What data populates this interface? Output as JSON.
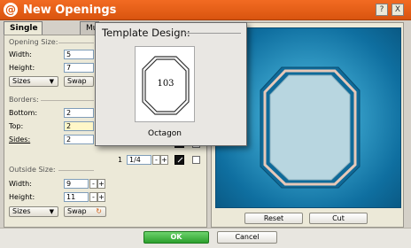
{
  "window": {
    "title": "New Openings",
    "help_label": "?",
    "close_label": "X"
  },
  "tabs": [
    {
      "label": "Single"
    },
    {
      "label": "Mu"
    }
  ],
  "opening_size": {
    "header": "Opening Size:",
    "width_label": "Width:",
    "width_value": "5",
    "height_label": "Height:",
    "height_value": "7",
    "sizes_label": "Sizes",
    "swap_label": "Swap"
  },
  "borders": {
    "header": "Borders:",
    "bottom_label": "Bottom:",
    "bottom_value": "2",
    "top_label": "Top:",
    "top_value": "2",
    "sides_label": "Sides:",
    "sides_value": "2"
  },
  "fraction_row": {
    "index": "1",
    "value": "1/4",
    "minus": "-",
    "plus": "+"
  },
  "outside_size": {
    "header": "Outside Size:",
    "width_label": "Width:",
    "width_value": "9",
    "height_label": "Height:",
    "height_value": "11",
    "sizes_label": "Sizes",
    "swap_label": "Swap"
  },
  "stepper": {
    "minus": "-",
    "plus": "+"
  },
  "preview": {
    "reset_label": "Reset",
    "cut_label": "Cut"
  },
  "footer": {
    "ok_label": "OK",
    "cancel_label": "Cancel"
  },
  "template_popup": {
    "title": "Template Design:",
    "design_number": "103",
    "design_name": "Octagon"
  },
  "colors": {
    "titlebar": "#e65f14",
    "preview": "#1a8fc4",
    "ok": "#2da02d"
  }
}
